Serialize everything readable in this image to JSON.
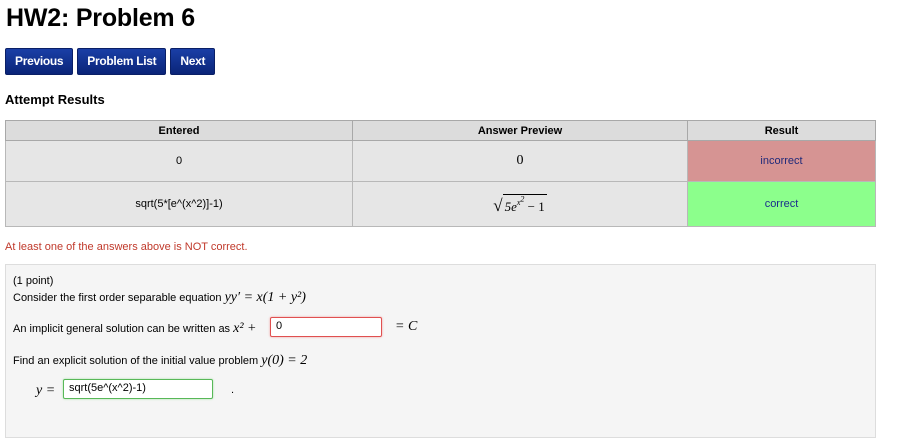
{
  "page": {
    "title": "HW2: Problem 6"
  },
  "nav": {
    "previous": "Previous",
    "problem_list": "Problem List",
    "next": "Next"
  },
  "attempt": {
    "heading": "Attempt Results",
    "columns": [
      "Entered",
      "Answer Preview",
      "Result"
    ],
    "rows": [
      {
        "entered": "0",
        "preview": "0",
        "result": "incorrect"
      },
      {
        "entered": "sqrt(5*[e^(x^2)]-1)",
        "preview_radicand": "5e",
        "preview_exp": "x",
        "preview_exp2": "2",
        "preview_tail": "− 1",
        "result": "correct"
      }
    ],
    "warning": "At least one of the answers above is NOT correct."
  },
  "problem": {
    "points": "(1 point)",
    "statement": "Consider the first order separable equation",
    "equation": "yy′ = x(1 + y²)",
    "implicit_prompt": "An implicit general solution can be written as",
    "implicit_lhs": "x² +",
    "implicit_value": "0",
    "implicit_rhs": "= C",
    "explicit_prompt": "Find an explicit solution of the initial value problem",
    "ivp": "y(0) = 2",
    "explicit_lhs": "y =",
    "explicit_value": "sqrt(5e^(x^2)-1)",
    "explicit_tail": "."
  },
  "colors": {
    "nav_button": "#0b2d8f",
    "incorrect": "#d69493",
    "correct": "#8cff8c",
    "warning_text": "#c0392b"
  }
}
